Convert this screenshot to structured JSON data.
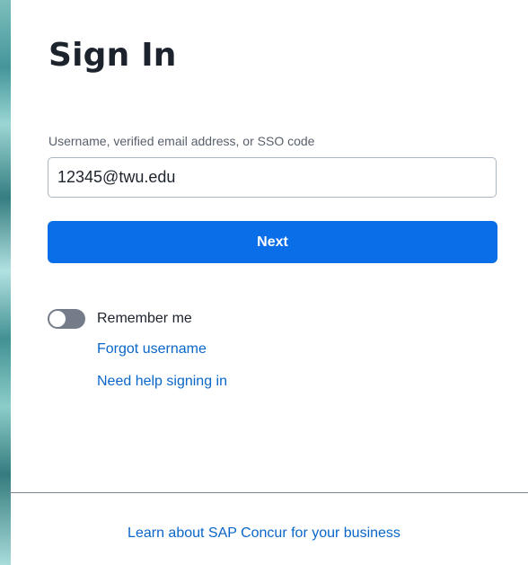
{
  "page": {
    "title": "Sign In"
  },
  "login": {
    "field_label": "Username, verified email address, or SSO code",
    "username_value": "12345@twu.edu",
    "next_label": "Next",
    "remember_label": "Remember me",
    "remember_on": false
  },
  "links": {
    "forgot_username": "Forgot username",
    "need_help": "Need help signing in"
  },
  "footer": {
    "learn_more": "Learn about SAP Concur for your business"
  },
  "colors": {
    "primary": "#0a6ee8",
    "link": "#0a66c8",
    "title_text": "#1d232c",
    "toggle_off": "#737c88"
  },
  "icons": {
    "toggle": "toggle-switch-icon"
  }
}
